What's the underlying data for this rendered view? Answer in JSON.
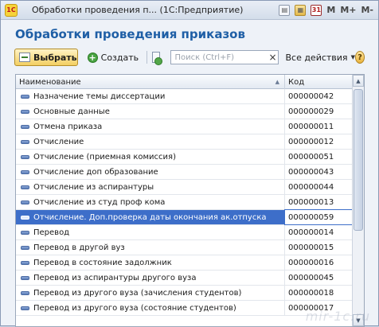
{
  "window": {
    "title": "Обработки проведения п...  (1С:Предприятие)",
    "toolbar_m": "M",
    "toolbar_mplus": "M+",
    "toolbar_mminus": "M-",
    "logo_text": "1С"
  },
  "form": {
    "title": "Обработки проведения приказов"
  },
  "toolbar": {
    "select_label": "Выбрать",
    "create_label": "Создать",
    "search_placeholder": "Поиск (Ctrl+F)",
    "search_clear": "×",
    "all_actions_label": "Все действия",
    "help_label": "?"
  },
  "list": {
    "columns": {
      "name": "Наименование",
      "code": "Код"
    },
    "rows": [
      {
        "name": "Назначение темы диссертации",
        "code": "000000042"
      },
      {
        "name": "Основные данные",
        "code": "000000029"
      },
      {
        "name": "Отмена приказа",
        "code": "000000011"
      },
      {
        "name": "Отчисление",
        "code": "000000012"
      },
      {
        "name": "Отчисление (приемная комиссия)",
        "code": "000000051"
      },
      {
        "name": "Отчисление доп образование",
        "code": "000000043"
      },
      {
        "name": "Отчисление из аспирантуры",
        "code": "000000044"
      },
      {
        "name": "Отчисление из студ проф кома",
        "code": "000000013"
      },
      {
        "name": "Отчисление. Доп.проверка даты окончания ак.отпуска",
        "code": "000000059",
        "selected": true
      },
      {
        "name": "Перевод",
        "code": "000000014"
      },
      {
        "name": "Перевод в другой вуз",
        "code": "000000015"
      },
      {
        "name": "Перевод в состояние задолжник",
        "code": "000000016"
      },
      {
        "name": "Перевод из аспирантуры другого вуза",
        "code": "000000045"
      },
      {
        "name": "Перевод из другого вуза (зачисления студентов)",
        "code": "000000018"
      },
      {
        "name": "Перевод из другого вуза (состояние студентов)",
        "code": "000000017"
      }
    ]
  },
  "watermark": "mir-1c.ru",
  "colors": {
    "accent": "#1f5fa6",
    "selection": "#3d6ec9",
    "select_button": "#f3cf63"
  }
}
